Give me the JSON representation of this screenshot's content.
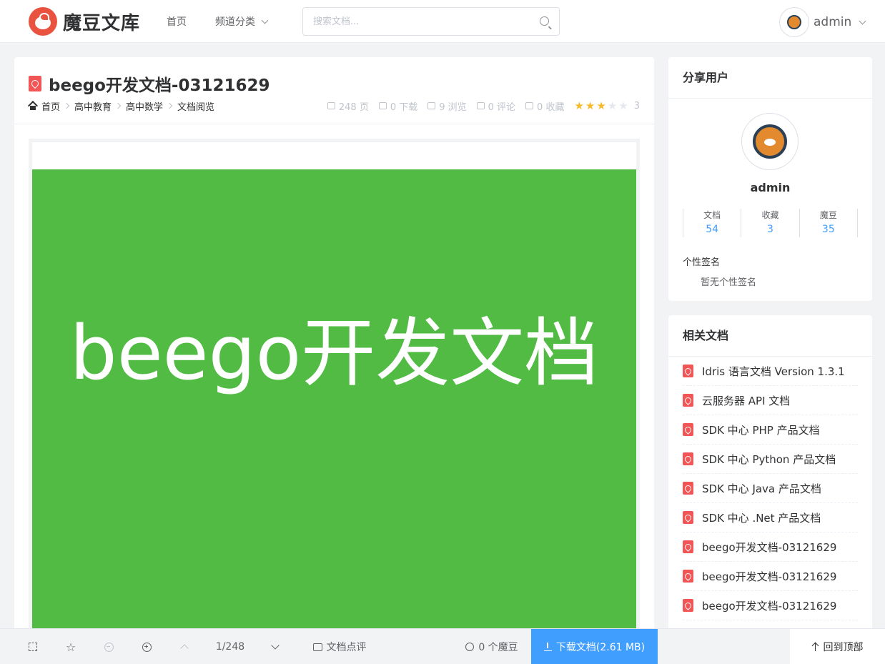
{
  "header": {
    "logo_text": "魔豆文库",
    "nav": {
      "home": "首页",
      "category": "频道分类"
    },
    "search_placeholder": "搜索文档...",
    "user_name": "admin"
  },
  "document": {
    "title": "beego开发文档-03121629",
    "breadcrumb": [
      "首页",
      "高中教育",
      "高中数学",
      "文档阅览"
    ],
    "stats": {
      "pages": "248 页",
      "downloads": "0 下载",
      "views": "9 浏览",
      "comments": "0 评论",
      "favorites": "0 收藏"
    },
    "rating": {
      "score": 3,
      "max": 5,
      "label": "3"
    },
    "cover_text": "beego开发文档",
    "cover_color": "#51bb44"
  },
  "sharer": {
    "heading": "分享用户",
    "name": "admin",
    "stats": [
      {
        "label": "文档",
        "value": "54"
      },
      {
        "label": "收藏",
        "value": "3"
      },
      {
        "label": "魔豆",
        "value": "35"
      }
    ],
    "signature_label": "个性签名",
    "signature": "暂无个性签名"
  },
  "related": {
    "heading": "相关文档",
    "items": [
      "Idris 语言文档 Version 1.3.1",
      "云服务器 API 文档",
      "SDK 中心 PHP 产品文档",
      "SDK 中心 Python 产品文档",
      "SDK 中心 Java 产品文档",
      "SDK 中心 .Net 产品文档",
      "beego开发文档-03121629",
      "beego开发文档-03121629",
      "beego开发文档-03121629"
    ]
  },
  "toolbar": {
    "page_indicator": "1/248",
    "comment": "文档点评",
    "coins": "0 个魔豆",
    "download": "下载文档(2.61 MB)",
    "back_to_top": "回到顶部"
  },
  "colors": {
    "accent": "#409eff",
    "star": "#f7ba2a",
    "pdf": "#f25555"
  }
}
